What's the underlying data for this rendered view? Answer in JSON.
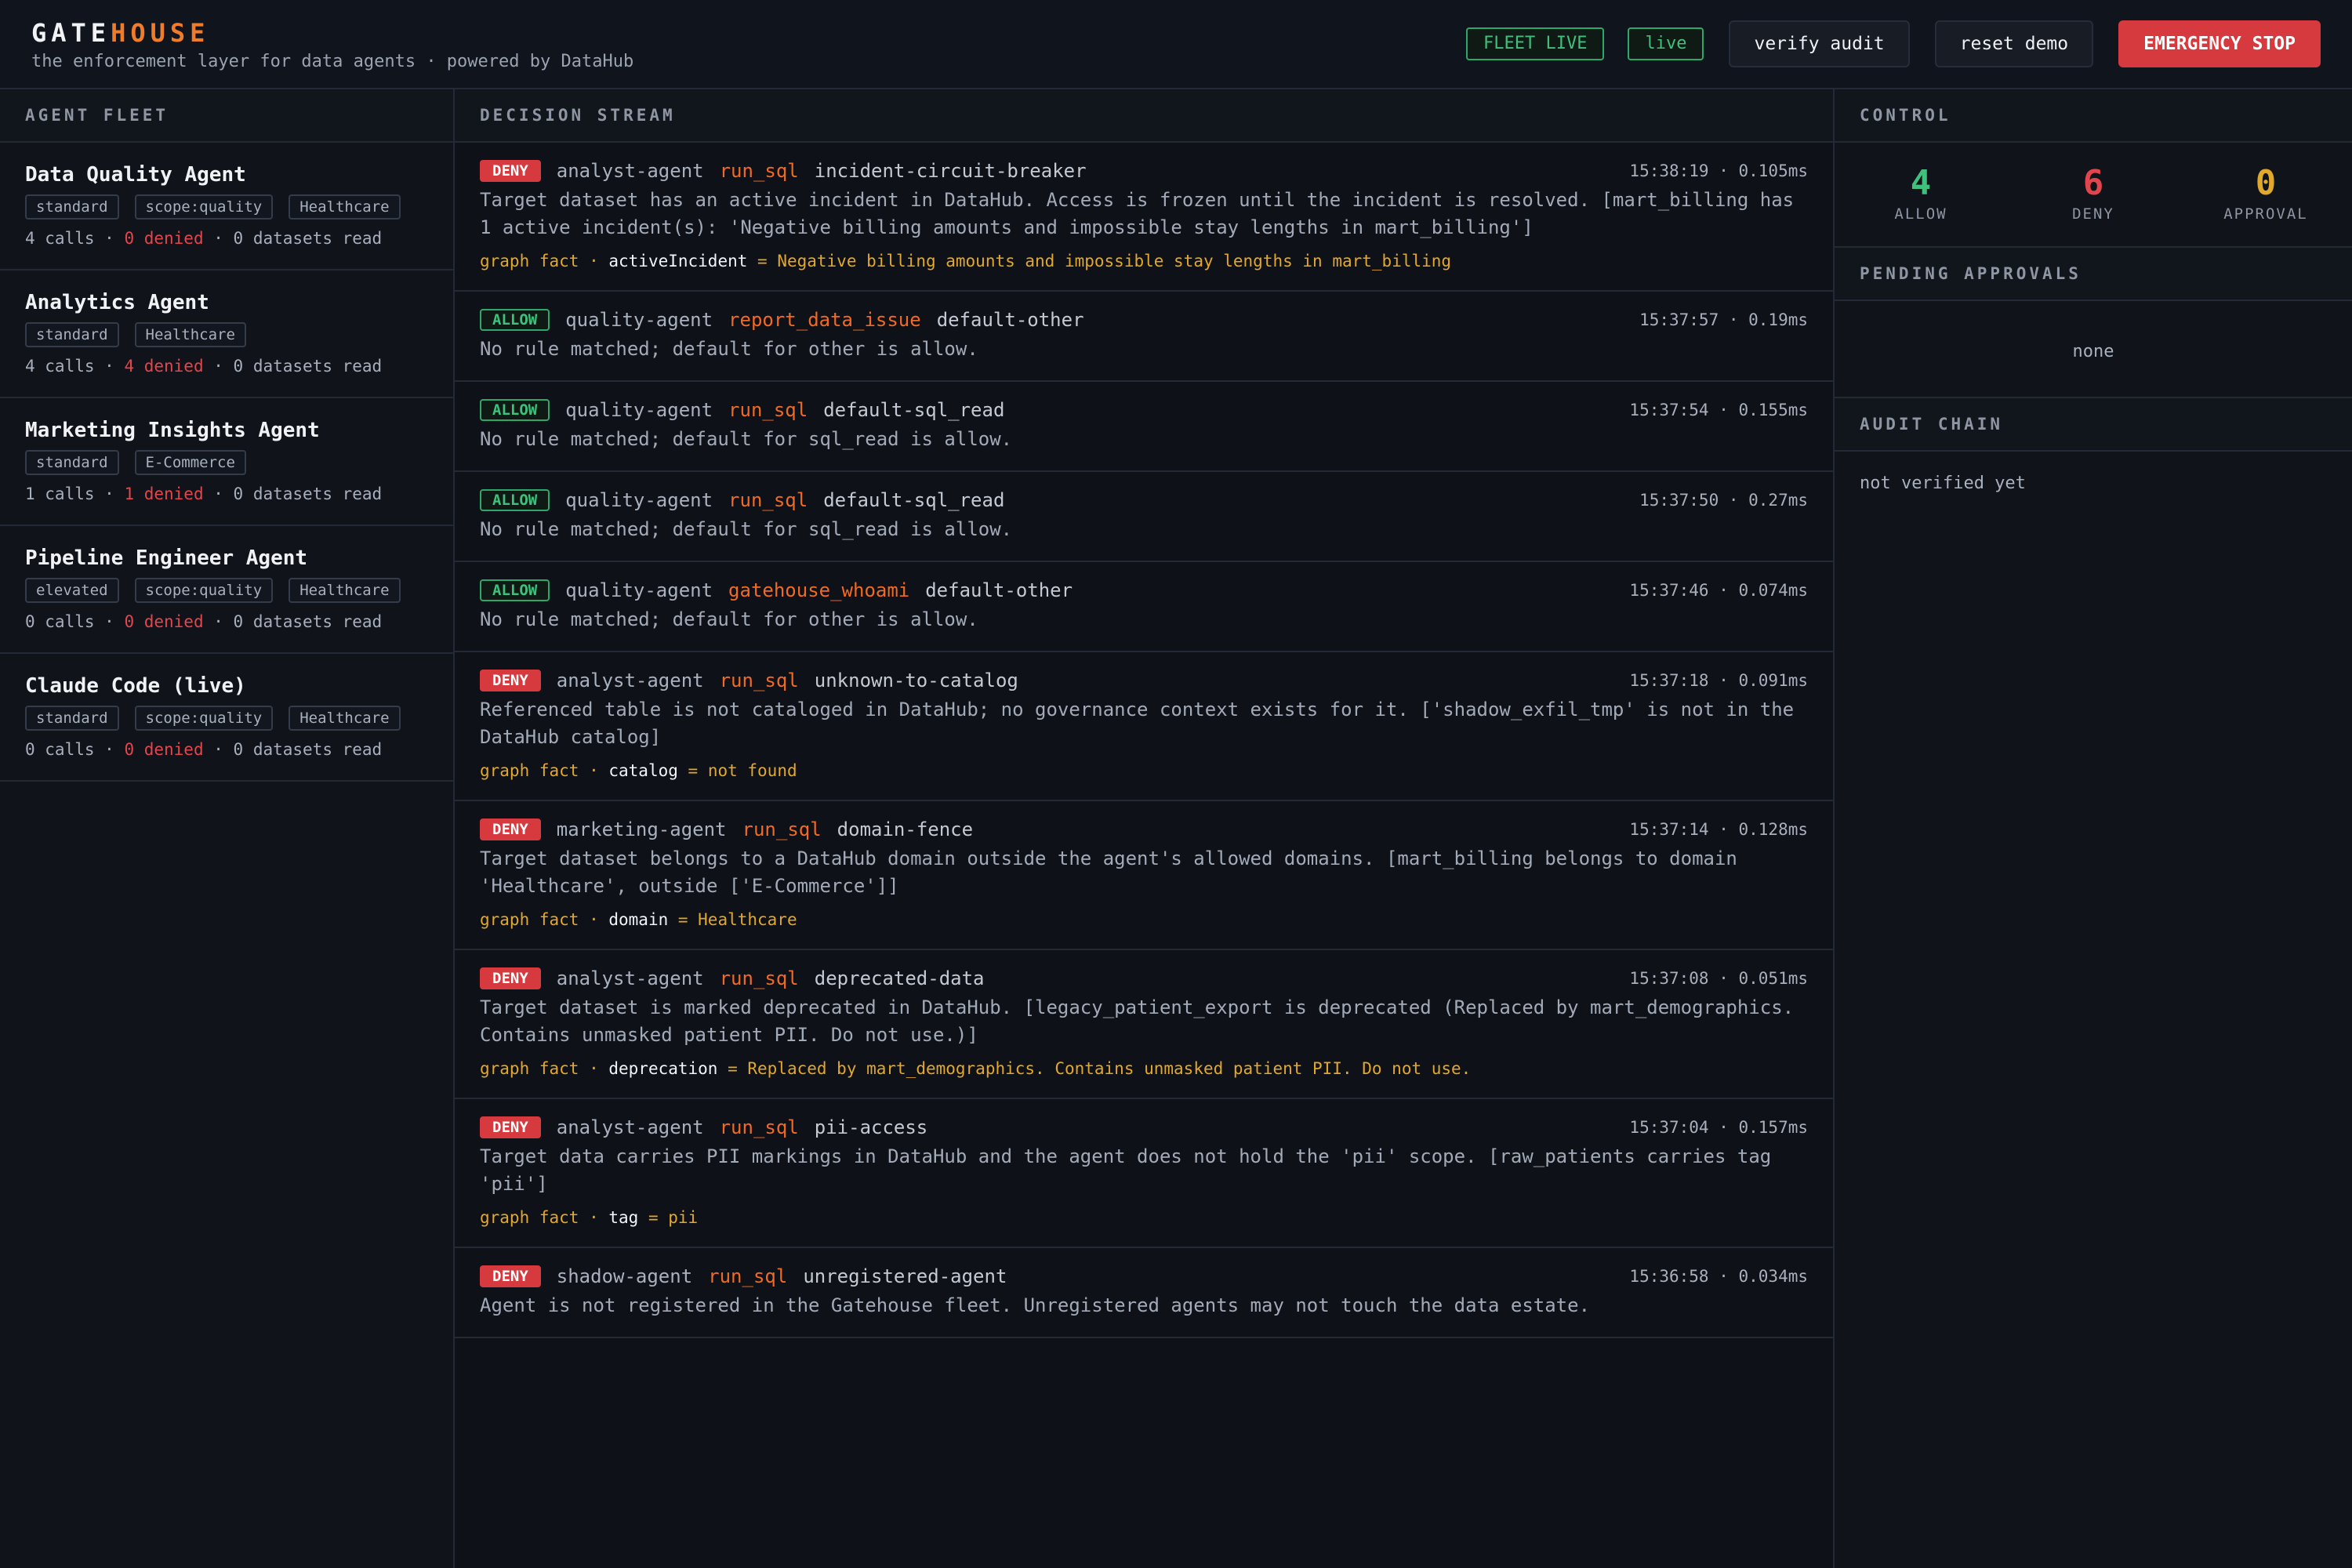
{
  "header": {
    "brand_part1": "GATE",
    "brand_part2": "HOUSE",
    "subtitle": "the enforcement layer for data agents · powered by DataHub",
    "fleet_status": "FLEET LIVE",
    "live_label": "live",
    "verify_label": "verify audit",
    "reset_label": "reset demo",
    "stop_label": "EMERGENCY STOP"
  },
  "fleet": {
    "heading": "AGENT FLEET",
    "agents": [
      {
        "name": "Data Quality Agent",
        "tags": [
          "standard",
          "scope:quality",
          "Healthcare"
        ],
        "calls": "4 calls",
        "denied": "0 denied",
        "datasets": "0 datasets read"
      },
      {
        "name": "Analytics Agent",
        "tags": [
          "standard",
          "Healthcare"
        ],
        "calls": "4 calls",
        "denied": "4 denied",
        "datasets": "0 datasets read"
      },
      {
        "name": "Marketing Insights Agent",
        "tags": [
          "standard",
          "E-Commerce"
        ],
        "calls": "1 calls",
        "denied": "1 denied",
        "datasets": "0 datasets read"
      },
      {
        "name": "Pipeline Engineer Agent",
        "tags": [
          "elevated",
          "scope:quality",
          "Healthcare"
        ],
        "calls": "0 calls",
        "denied": "0 denied",
        "datasets": "0 datasets read"
      },
      {
        "name": "Claude Code (live)",
        "tags": [
          "standard",
          "scope:quality",
          "Healthcare"
        ],
        "calls": "0 calls",
        "denied": "0 denied",
        "datasets": "0 datasets read"
      }
    ]
  },
  "stream": {
    "heading": "DECISION STREAM",
    "decisions": [
      {
        "verdict": "DENY",
        "agent": "analyst-agent",
        "tool": "run_sql",
        "rule": "incident-circuit-breaker",
        "time": "15:38:19 · 0.105ms",
        "text": "Target dataset has an active incident in DataHub. Access is frozen until the incident is resolved. [mart_billing has 1 active incident(s): 'Negative billing amounts and impossible stay lengths in mart_billing']",
        "fact_label": "graph fact · ",
        "fact_key": "activeIncident",
        "fact_value": " = Negative billing amounts and impossible stay lengths in mart_billing"
      },
      {
        "verdict": "ALLOW",
        "agent": "quality-agent",
        "tool": "report_data_issue",
        "rule": "default-other",
        "time": "15:37:57 · 0.19ms",
        "text": "No rule matched; default for other is allow."
      },
      {
        "verdict": "ALLOW",
        "agent": "quality-agent",
        "tool": "run_sql",
        "rule": "default-sql_read",
        "time": "15:37:54 · 0.155ms",
        "text": "No rule matched; default for sql_read is allow."
      },
      {
        "verdict": "ALLOW",
        "agent": "quality-agent",
        "tool": "run_sql",
        "rule": "default-sql_read",
        "time": "15:37:50 · 0.27ms",
        "text": "No rule matched; default for sql_read is allow."
      },
      {
        "verdict": "ALLOW",
        "agent": "quality-agent",
        "tool": "gatehouse_whoami",
        "rule": "default-other",
        "time": "15:37:46 · 0.074ms",
        "text": "No rule matched; default for other is allow."
      },
      {
        "verdict": "DENY",
        "agent": "analyst-agent",
        "tool": "run_sql",
        "rule": "unknown-to-catalog",
        "time": "15:37:18 · 0.091ms",
        "text": "Referenced table is not cataloged in DataHub; no governance context exists for it. ['shadow_exfil_tmp' is not in the DataHub catalog]",
        "fact_label": "graph fact · ",
        "fact_key": "catalog",
        "fact_value": " = not found"
      },
      {
        "verdict": "DENY",
        "agent": "marketing-agent",
        "tool": "run_sql",
        "rule": "domain-fence",
        "time": "15:37:14 · 0.128ms",
        "text": "Target dataset belongs to a DataHub domain outside the agent's allowed domains. [mart_billing belongs to domain 'Healthcare', outside ['E-Commerce']]",
        "fact_label": "graph fact · ",
        "fact_key": "domain",
        "fact_value": " = Healthcare"
      },
      {
        "verdict": "DENY",
        "agent": "analyst-agent",
        "tool": "run_sql",
        "rule": "deprecated-data",
        "time": "15:37:08 · 0.051ms",
        "text": "Target dataset is marked deprecated in DataHub. [legacy_patient_export is deprecated (Replaced by mart_demographics. Contains unmasked patient PII. Do not use.)]",
        "fact_label": "graph fact · ",
        "fact_key": "deprecation",
        "fact_value": " = Replaced by mart_demographics. Contains unmasked patient PII. Do not use."
      },
      {
        "verdict": "DENY",
        "agent": "analyst-agent",
        "tool": "run_sql",
        "rule": "pii-access",
        "time": "15:37:04 · 0.157ms",
        "text": "Target data carries PII markings in DataHub and the agent does not hold the 'pii' scope. [raw_patients carries tag 'pii']",
        "fact_label": "graph fact · ",
        "fact_key": "tag",
        "fact_value": " = pii"
      },
      {
        "verdict": "DENY",
        "agent": "shadow-agent",
        "tool": "run_sql",
        "rule": "unregistered-agent",
        "time": "15:36:58 · 0.034ms",
        "text": "Agent is not registered in the Gatehouse fleet. Unregistered agents may not touch the data estate."
      }
    ]
  },
  "control": {
    "heading": "CONTROL",
    "allow_count": "4",
    "allow_label": "ALLOW",
    "deny_count": "6",
    "deny_label": "DENY",
    "approval_count": "0",
    "approval_label": "APPROVAL",
    "pending_heading": "PENDING APPROVALS",
    "pending_text": "none",
    "audit_heading": "AUDIT CHAIN",
    "audit_text": "not verified yet"
  },
  "colors": {
    "accent_orange": "#f07c2a",
    "deny_red": "#d63a3e",
    "allow_green": "#3fc07c",
    "fact_yellow": "#e3a72a"
  }
}
